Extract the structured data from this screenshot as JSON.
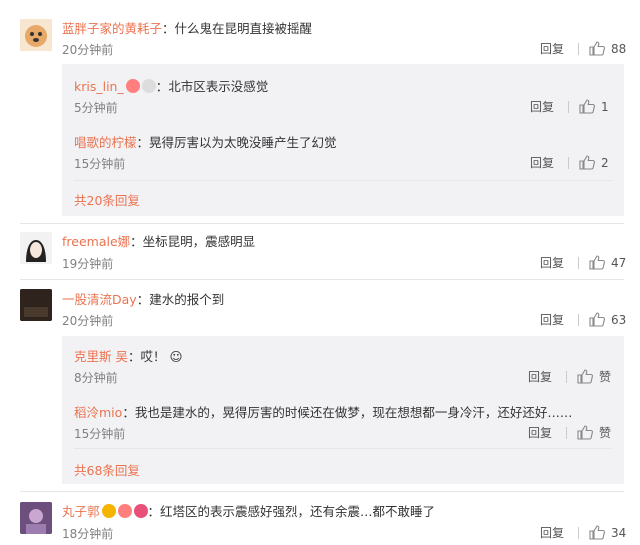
{
  "comments": [
    {
      "name": "蓝胖子家的黄耗子",
      "text": "：什么鬼在昆明直接被摇醒",
      "time": "20分钟前",
      "reply": "回复",
      "likes": "88"
    },
    {
      "name": "freemale娜",
      "text": "：坐标昆明，震感明显",
      "time": "19分钟前",
      "reply": "回复",
      "likes": "47"
    },
    {
      "name": "一股清流Day",
      "text": "：建水的报个到",
      "time": "20分钟前",
      "reply": "回复",
      "likes": "63"
    },
    {
      "name": "丸子郭",
      "text": "：红塔区的表示震感好强烈，还有余震…都不敢睡了",
      "time": "18分钟前",
      "reply": "回复",
      "likes": "34"
    }
  ],
  "replies_1": [
    {
      "name": "kris_lin_",
      "text": "：北市区表示没感觉",
      "time": "5分钟前",
      "reply": "回复",
      "likes": "1"
    },
    {
      "name": "唱歌的柠檬",
      "text": "：晃得厉害以为太晚没睡产生了幻觉",
      "time": "15分钟前",
      "reply": "回复",
      "likes": "2"
    }
  ],
  "replies_1_more": "共20条回复",
  "replies_3": [
    {
      "name": "克里斯 吴",
      "text": "：哎！",
      "time": "8分钟前",
      "reply": "回复",
      "likes": "赞"
    },
    {
      "name": "稻泠mio",
      "text": "：我也是建水的，晃得厉害的时候还在做梦，现在想想都一身冷汗，还好还好……",
      "time": "15分钟前",
      "reply": "回复",
      "likes": "赞"
    }
  ],
  "replies_3_more": "共68条回复",
  "colors": {
    "name": "#eb7350",
    "time": "#808080",
    "reply_bg": "#f2f2f5"
  }
}
